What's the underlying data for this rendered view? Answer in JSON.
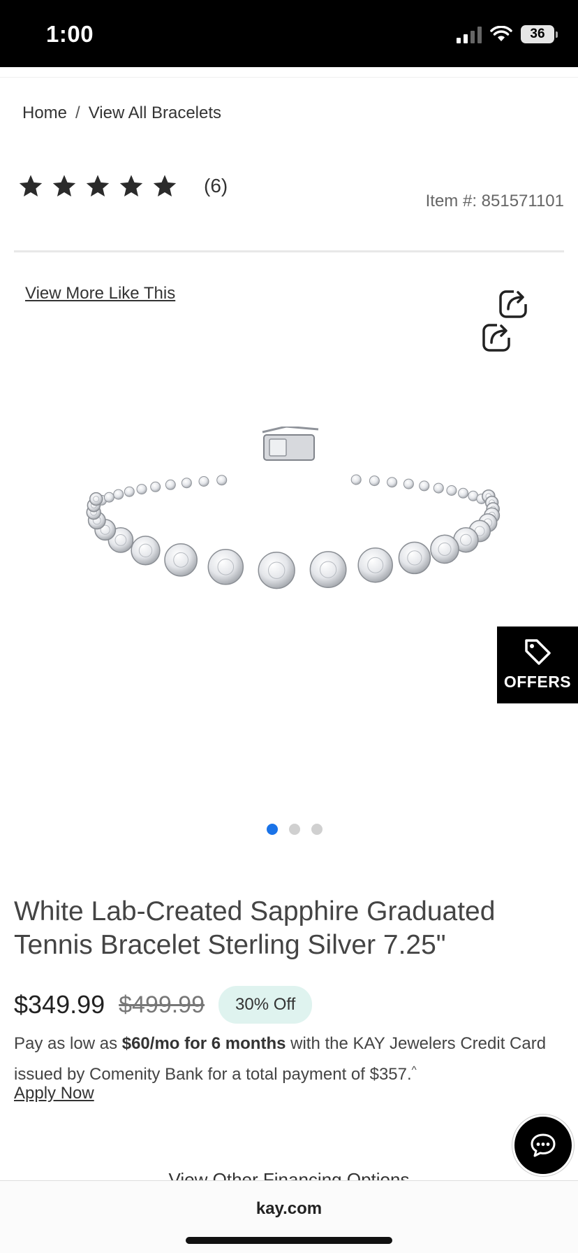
{
  "status_bar": {
    "time": "1:00",
    "battery": "36"
  },
  "breadcrumb": {
    "home": "Home",
    "separator": "/",
    "current": "View All Bracelets"
  },
  "rating": {
    "stars": 5,
    "count": "(6)"
  },
  "item_number": "Item #: 851571101",
  "view_more": "View More Like This",
  "carousel": {
    "total": 3,
    "active": 1
  },
  "offers_label": "OFFERS",
  "product": {
    "title": "White Lab-Created Sapphire Graduated Tennis Bracelet Sterling Silver 7.25\"",
    "price_current": "$349.99",
    "price_original": "$499.99",
    "discount": "30% Off"
  },
  "financing": {
    "prefix": "Pay as low as ",
    "bold": "$60/mo for 6 months",
    "suffix": " with the KAY Jewelers Credit Card issued by Comenity Bank for a total payment of $357.",
    "footnote_mark": "^",
    "apply_label": "Apply Now",
    "other_options": "View Other Financing Options"
  },
  "browser": {
    "url": "kay.com"
  }
}
